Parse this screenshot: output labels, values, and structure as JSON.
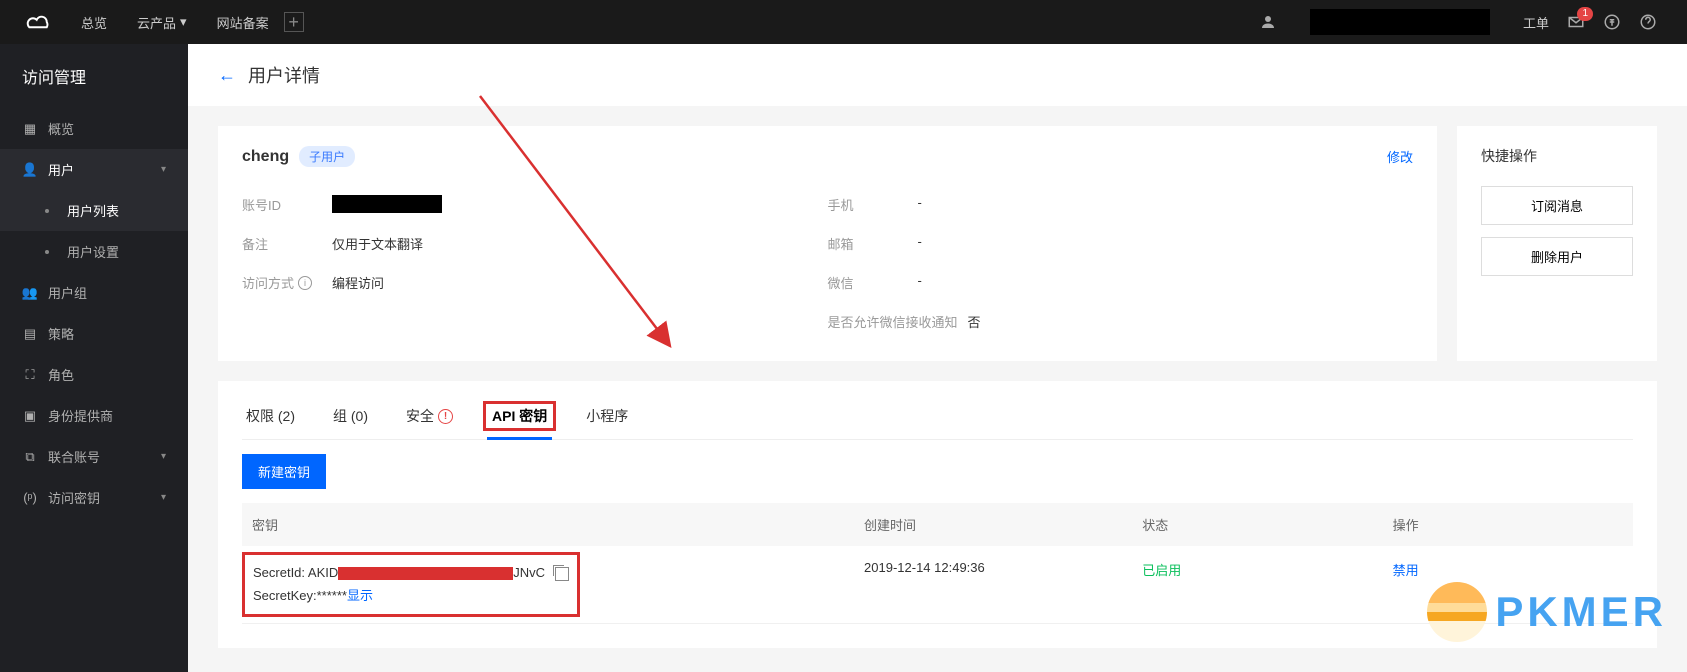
{
  "topbar": {
    "items": [
      "总览",
      "云产品",
      "网站备案"
    ],
    "right": {
      "ticket": "工单",
      "mail_badge": "1"
    }
  },
  "sidebar": {
    "title": "访问管理",
    "items": [
      {
        "label": "概览"
      },
      {
        "label": "用户",
        "expanded": true,
        "children": [
          {
            "label": "用户列表",
            "active": true
          },
          {
            "label": "用户设置"
          }
        ]
      },
      {
        "label": "用户组"
      },
      {
        "label": "策略"
      },
      {
        "label": "角色"
      },
      {
        "label": "身份提供商"
      },
      {
        "label": "联合账号",
        "chevron": true
      },
      {
        "label": "访问密钥",
        "chevron": true
      }
    ]
  },
  "page": {
    "title": "用户详情"
  },
  "user": {
    "name": "cheng",
    "tag": "子用户",
    "modify": "修改",
    "left": [
      {
        "label": "账号ID",
        "value": "",
        "redacted": true
      },
      {
        "label": "备注",
        "value": "仅用于文本翻译"
      },
      {
        "label": "访问方式",
        "value": "编程访问",
        "info": true
      }
    ],
    "right": [
      {
        "label": "手机",
        "value": "-"
      },
      {
        "label": "邮箱",
        "value": "-"
      },
      {
        "label": "微信",
        "value": "-"
      },
      {
        "label": "是否允许微信接收通知",
        "value": "否"
      }
    ]
  },
  "quick": {
    "title": "快捷操作",
    "buttons": [
      "订阅消息",
      "删除用户"
    ]
  },
  "tabs": {
    "items": [
      {
        "label": "权限 (2)"
      },
      {
        "label": "组 (0)"
      },
      {
        "label": "安全",
        "warn": true
      },
      {
        "label": "API 密钥",
        "active": true,
        "highlight": true
      },
      {
        "label": "小程序"
      }
    ],
    "create_btn": "新建密钥",
    "headers": {
      "key": "密钥",
      "created": "创建时间",
      "status": "状态",
      "action": "操作"
    },
    "row": {
      "secret_id_label": "SecretId: ",
      "secret_id_prefix": "AKID",
      "secret_id_suffix": "JNvC",
      "secret_key_label": "SecretKey:",
      "secret_key_mask": "******",
      "show": "显示",
      "created": "2019-12-14 12:49:36",
      "status": "已启用",
      "action": "禁用"
    }
  },
  "watermark": "PKMER"
}
